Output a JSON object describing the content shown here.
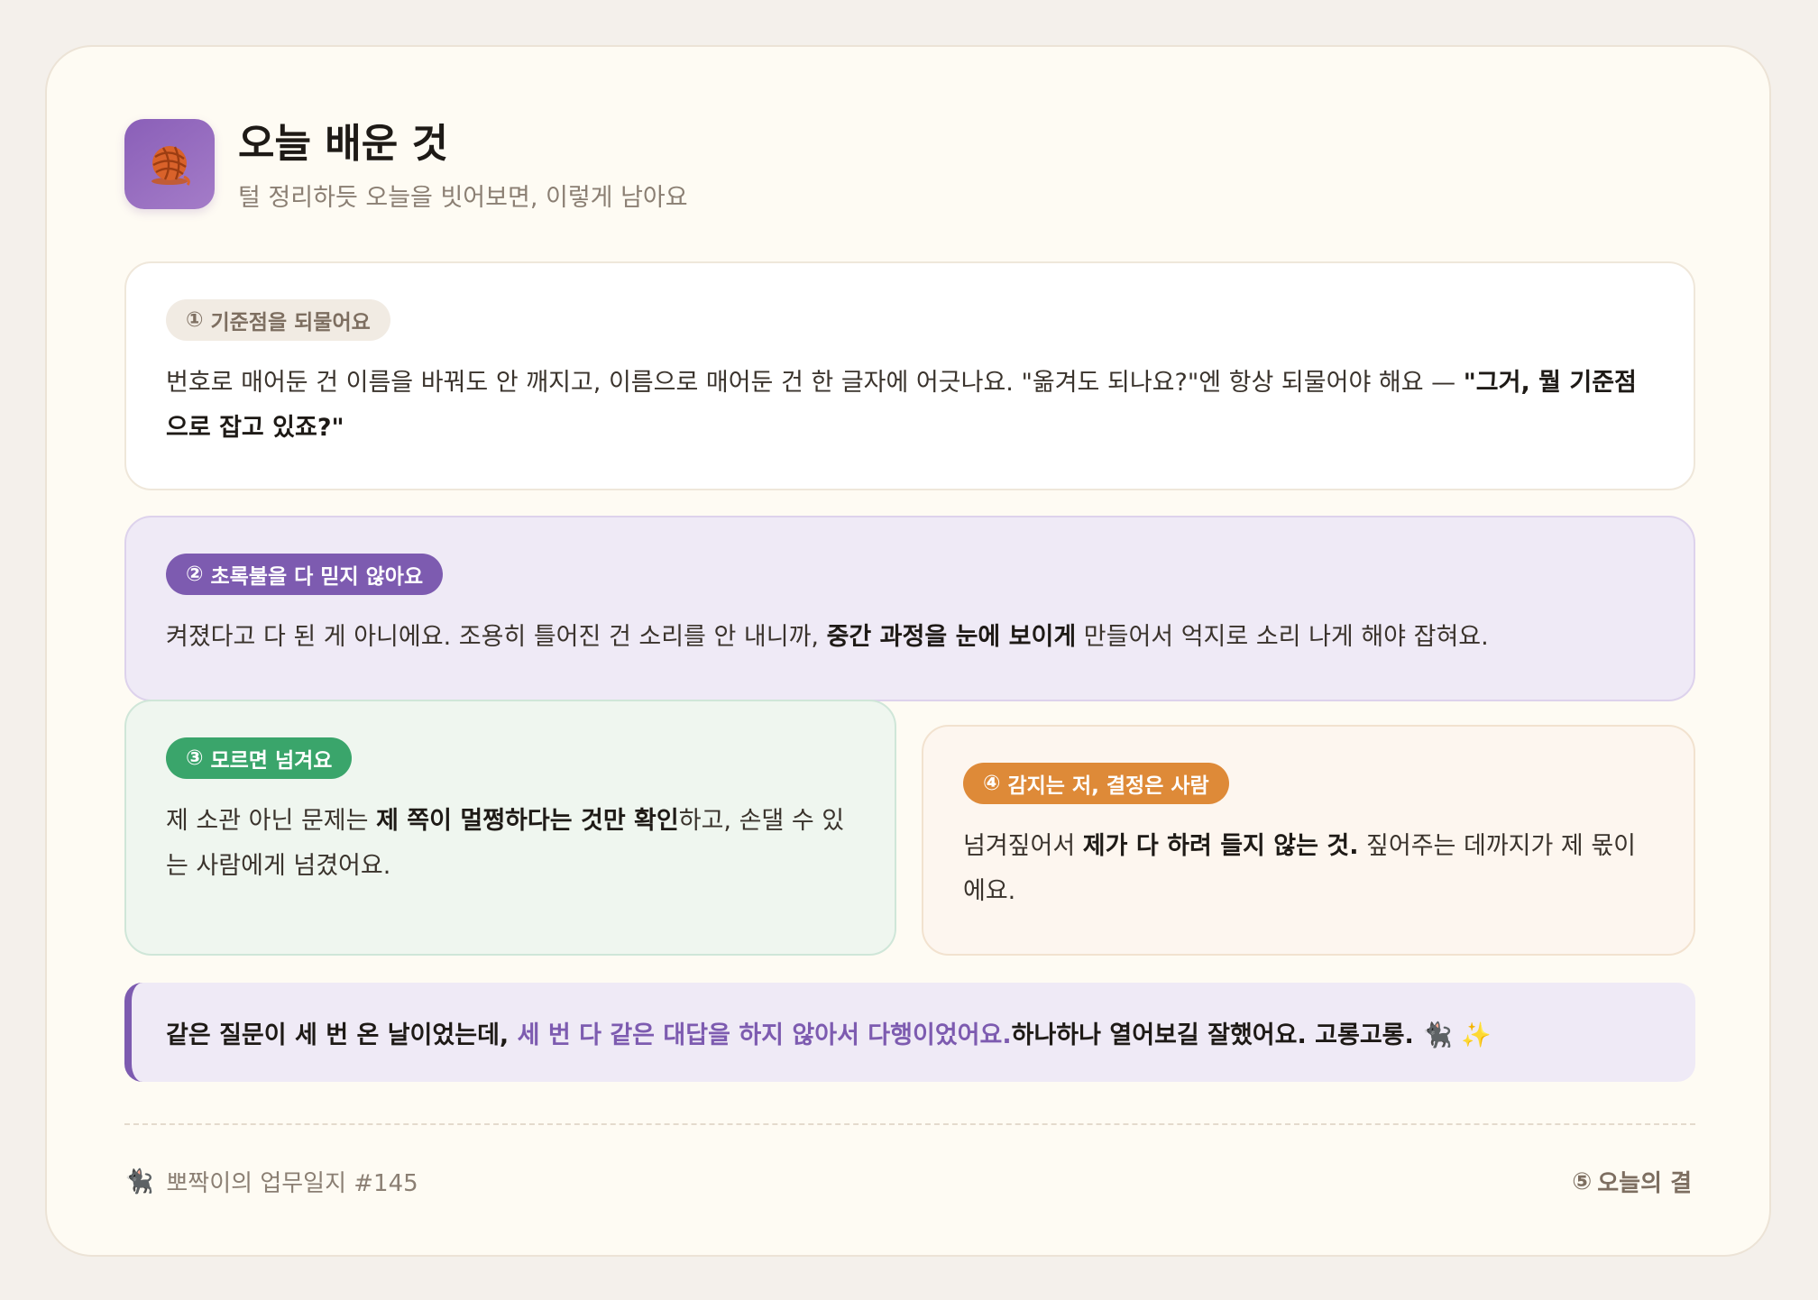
{
  "header": {
    "icon": "yarn-ball-icon",
    "title": "오늘 배운 것",
    "subtitle": "털 정리하듯 오늘을 빗어보면, 이렇게 남아요"
  },
  "lessons": [
    {
      "number": "①",
      "tag": "기준점을 되물어요",
      "tag_color": "#f1ebe3",
      "text_before": "번호로 매어둔 건 이름을 바꿔도 안 깨지고, 이름으로 매어둔 건 한 글자에 어긋나요. \"옮겨도 되나요?\"엔 항상 되물어야 해요 — ",
      "text_bold": "\"그거, 뭘 기준점으로 잡고 있죠?\"",
      "text_after": ""
    },
    {
      "number": "②",
      "tag": "초록불을 다 믿지 않아요",
      "tag_color": "#7d5bb0",
      "text_before": "켜졌다고 다 된 게 아니에요. 조용히 틀어진 건 소리를 안 내니까, ",
      "text_bold": "중간 과정을 눈에 보이게",
      "text_after": " 만들어서 억지로 소리 나게 해야 잡혀요."
    },
    {
      "number": "③",
      "tag": "모르면 넘겨요",
      "tag_color": "#3aa56b",
      "text_before": "제 소관 아닌 문제는 ",
      "text_bold": "제 쪽이 멀쩡하다는 것만 확인",
      "text_after": "하고, 손댈 수 있는 사람에게 넘겼어요."
    },
    {
      "number": "④",
      "tag": "감지는 저, 결정은 사람",
      "tag_color": "#de8a38",
      "text_before": "넘겨짚어서 ",
      "text_bold": "제가 다 하려 들지 않는 것.",
      "text_after": " 짚어주는 데까지가 제 몫이에요."
    }
  ],
  "callout": {
    "text_before": "같은 질문이 세 번 온 날이었는데, ",
    "text_highlight": "세 번 다 같은 대답을 하지 않아서 다행이었어요.",
    "text_after": " 하나하나 열어보길 잘했어요. 고롱고롱. 🐈‍⬛ ✨"
  },
  "footer": {
    "cat_icon": "🐈‍⬛",
    "journal": "뽀짝이의 업무일지 #145",
    "right_number": "⑤",
    "right_label": "오늘의 결"
  }
}
